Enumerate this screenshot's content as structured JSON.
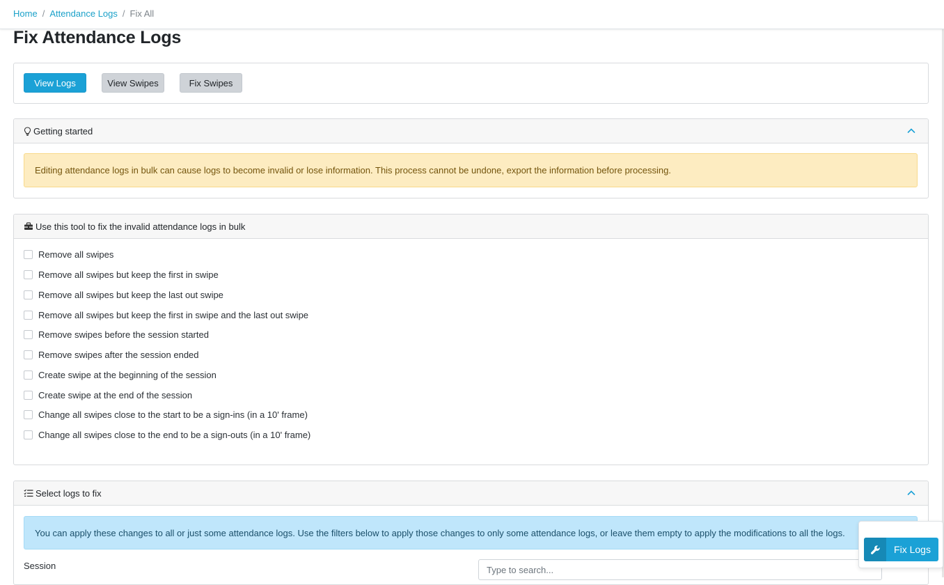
{
  "breadcrumb": {
    "home": "Home",
    "attendance_logs": "Attendance Logs",
    "current": "Fix All",
    "separator": "/"
  },
  "page": {
    "title": "Fix Attendance Logs"
  },
  "actions": {
    "view_logs": "View Logs",
    "view_swipes": "View Swipes",
    "fix_swipes": "Fix Swipes"
  },
  "getting_started": {
    "title": "Getting started",
    "icon": "lightbulb-icon",
    "warning": "Editing attendance logs in bulk can cause logs to become invalid or lose information. This process cannot be undone, export the information before processing."
  },
  "tool": {
    "title": "Use this tool to fix the invalid attendance logs in bulk",
    "icon": "toolbox-icon",
    "options": [
      "Remove all swipes",
      "Remove all swipes but keep the first in swipe",
      "Remove all swipes but keep the last out swipe",
      "Remove all swipes but keep the first in swipe and the last out swipe",
      "Remove swipes before the session started",
      "Remove swipes after the session ended",
      "Create swipe at the beginning of the session",
      "Create swipe at the end of the session",
      "Change all swipes close to the start to be a sign-ins (in a 10' frame)",
      "Change all swipes close to the end to be a sign-outs (in a 10' frame)"
    ]
  },
  "select_logs": {
    "title": "Select logs to fix",
    "icon": "task-list-icon",
    "info": "You can apply these changes to all or just some attendance logs. Use the filters below to apply those changes to only some attendance logs, or leave them empty to apply the modifications to all the logs.",
    "session_label": "Session",
    "search_placeholder": "Type to search..."
  },
  "floating": {
    "fix_logs": "Fix Logs",
    "icon": "wrench-icon"
  },
  "colors": {
    "primary": "#1ba1d6",
    "link": "#1ba1c9",
    "secondary": "#cfd3d8",
    "warning_bg": "#fdecc1",
    "info_bg": "#bfe6fb"
  }
}
